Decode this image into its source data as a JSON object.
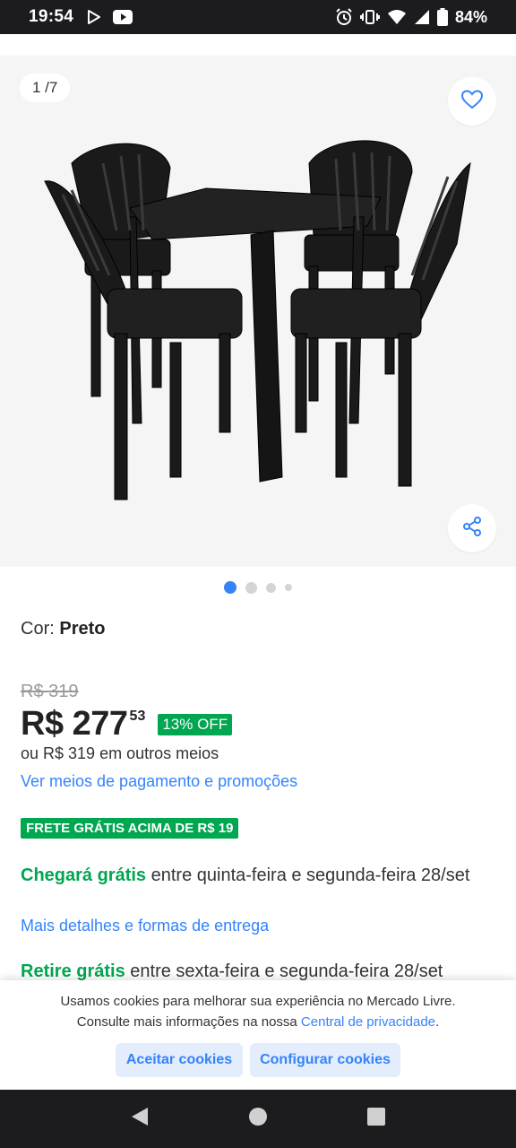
{
  "status_bar": {
    "time": "19:54",
    "battery": "84%",
    "icons": [
      "play-store-icon",
      "youtube-icon",
      "alarm-icon",
      "vibrate-icon",
      "wifi-icon",
      "signal-icon",
      "battery-icon"
    ]
  },
  "gallery": {
    "counter": "1 /7",
    "favorite_icon": "heart-icon",
    "share_icon": "share-icon",
    "dots_total": 4,
    "active_dot": 0
  },
  "product": {
    "color_label": "Cor:",
    "color_value": "Preto",
    "old_price": "R$ 319",
    "price_main": "R$ 277",
    "price_cents": "53",
    "discount": "13% OFF",
    "alt_price": "ou R$ 319 em outros meios",
    "payment_link": "Ver meios de pagamento e promoções",
    "free_shipping_badge": "FRETE GRÁTIS ACIMA DE R$ 19",
    "arrival_highlight": "Chegará grátis",
    "arrival_text": " entre quinta-feira e segunda-feira 28/set",
    "delivery_link": "Mais detalhes e formas de entrega",
    "pickup_highlight": "Retire grátis",
    "pickup_text": " entre sexta-feira e segunda-feira 28/set"
  },
  "cookie_banner": {
    "line1": "Usamos cookies para melhorar sua experiência no Mercado Livre.",
    "line2_prefix": "Consulte mais informações na nossa ",
    "line2_link": "Central de privacidade",
    "line2_suffix": ".",
    "accept_label": "Aceitar cookies",
    "configure_label": "Configurar cookies"
  },
  "colors": {
    "accent_blue": "#3483fa",
    "success_green": "#00a650",
    "system_bar": "#1c1c1e"
  }
}
